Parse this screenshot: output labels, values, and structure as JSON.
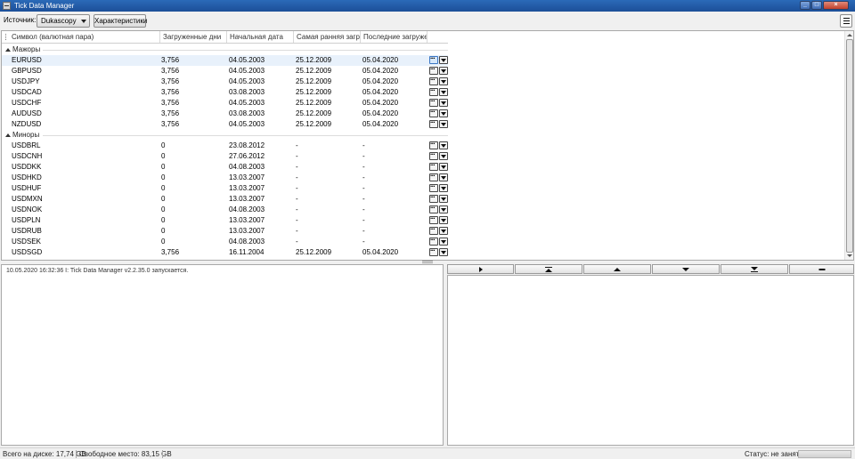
{
  "window": {
    "title": "Tick Data Manager"
  },
  "toolbar": {
    "source_label": "Источник:",
    "source_value": "Dukascopy",
    "characteristics_button": "Характеристики"
  },
  "grid": {
    "columns": [
      "Символ (валютная пара)",
      "Загруженные дни",
      "Начальная дата",
      "Самая ранняя загр...",
      "Последние загруже..."
    ],
    "groups": [
      {
        "label": "Мажоры",
        "rows": [
          {
            "symbol": "EURUSD",
            "days": "3,756",
            "start": "04.05.2003",
            "earliest": "25.12.2009",
            "latest": "05.04.2020"
          },
          {
            "symbol": "GBPUSD",
            "days": "3,756",
            "start": "04.05.2003",
            "earliest": "25.12.2009",
            "latest": "05.04.2020"
          },
          {
            "symbol": "USDJPY",
            "days": "3,756",
            "start": "04.05.2003",
            "earliest": "25.12.2009",
            "latest": "05.04.2020"
          },
          {
            "symbol": "USDCAD",
            "days": "3,756",
            "start": "03.08.2003",
            "earliest": "25.12.2009",
            "latest": "05.04.2020"
          },
          {
            "symbol": "USDCHF",
            "days": "3,756",
            "start": "04.05.2003",
            "earliest": "25.12.2009",
            "latest": "05.04.2020"
          },
          {
            "symbol": "AUDUSD",
            "days": "3,756",
            "start": "03.08.2003",
            "earliest": "25.12.2009",
            "latest": "05.04.2020"
          },
          {
            "symbol": "NZDUSD",
            "days": "3,756",
            "start": "04.05.2003",
            "earliest": "25.12.2009",
            "latest": "05.04.2020"
          }
        ]
      },
      {
        "label": "Миноры",
        "rows": [
          {
            "symbol": "USDBRL",
            "days": "0",
            "start": "23.08.2012",
            "earliest": "-",
            "latest": "-"
          },
          {
            "symbol": "USDCNH",
            "days": "0",
            "start": "27.06.2012",
            "earliest": "-",
            "latest": "-"
          },
          {
            "symbol": "USDDKK",
            "days": "0",
            "start": "04.08.2003",
            "earliest": "-",
            "latest": "-"
          },
          {
            "symbol": "USDHKD",
            "days": "0",
            "start": "13.03.2007",
            "earliest": "-",
            "latest": "-"
          },
          {
            "symbol": "USDHUF",
            "days": "0",
            "start": "13.03.2007",
            "earliest": "-",
            "latest": "-"
          },
          {
            "symbol": "USDMXN",
            "days": "0",
            "start": "13.03.2007",
            "earliest": "-",
            "latest": "-"
          },
          {
            "symbol": "USDNOK",
            "days": "0",
            "start": "04.08.2003",
            "earliest": "-",
            "latest": "-"
          },
          {
            "symbol": "USDPLN",
            "days": "0",
            "start": "13.03.2007",
            "earliest": "-",
            "latest": "-"
          },
          {
            "symbol": "USDRUB",
            "days": "0",
            "start": "13.03.2007",
            "earliest": "-",
            "latest": "-"
          },
          {
            "symbol": "USDSEK",
            "days": "0",
            "start": "04.08.2003",
            "earliest": "-",
            "latest": "-"
          },
          {
            "symbol": "USDSGD",
            "days": "3,756",
            "start": "16.11.2004",
            "earliest": "25.12.2009",
            "latest": "05.04.2020"
          }
        ]
      }
    ]
  },
  "log": {
    "lines": [
      "10.05.2020 16:32:36  I: Tick Data Manager v2.2.35.0 запускается."
    ]
  },
  "navigation": {
    "buttons": [
      "play-icon",
      "move-top-icon",
      "move-up-icon",
      "move-down-icon",
      "move-bottom-icon",
      "minus-icon"
    ]
  },
  "statusbar": {
    "disk_total": "Всего на диске: 17,74 GB",
    "free_space": "Свободное место: 83,15 GB",
    "status": "Статус: не занят"
  }
}
